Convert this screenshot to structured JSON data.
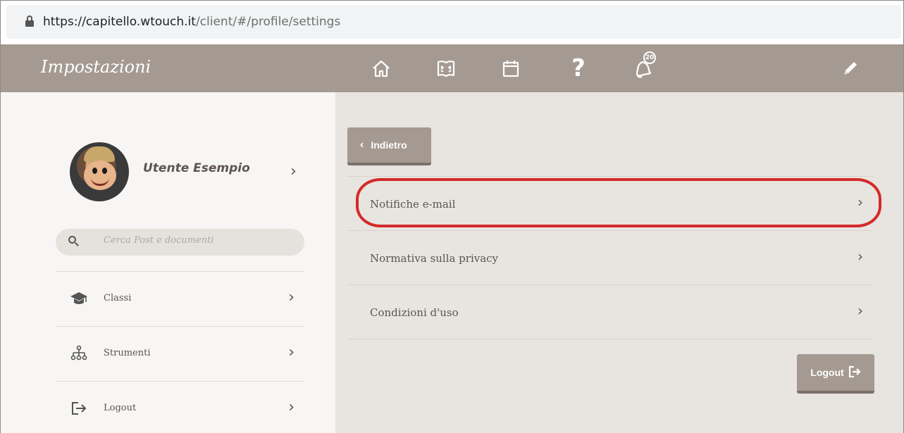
{
  "browser": {
    "url_host": "https://capitello.wtouch.it",
    "url_path": "/client/#/profile/settings"
  },
  "header": {
    "title": "Impostazioni",
    "nav_icons": [
      "home-icon",
      "book-icon",
      "calendar-icon",
      "help-icon",
      "notifications-icon",
      "edit-icon"
    ],
    "notifications_count": "20",
    "help_glyph": "?"
  },
  "sidebar": {
    "user_name": "Utente Esempio",
    "search_placeholder": "Cerca Post e documenti",
    "items": [
      {
        "label": "Classi",
        "icon": "graduation-cap-icon"
      },
      {
        "label": "Strumenti",
        "icon": "hierarchy-icon"
      },
      {
        "label": "Logout",
        "icon": "logout-icon"
      }
    ]
  },
  "main": {
    "back_label": "Indietro",
    "settings": [
      {
        "label": "Notifiche e-mail"
      },
      {
        "label": "Normativa sulla privacy"
      },
      {
        "label": "Condizioni d'uso"
      }
    ],
    "logout_label": "Logout"
  },
  "colors": {
    "brand": "#a49a91",
    "highlight": "#d42a2a",
    "panel_left": "#f8f6f4",
    "panel_right": "#e8e4df"
  }
}
